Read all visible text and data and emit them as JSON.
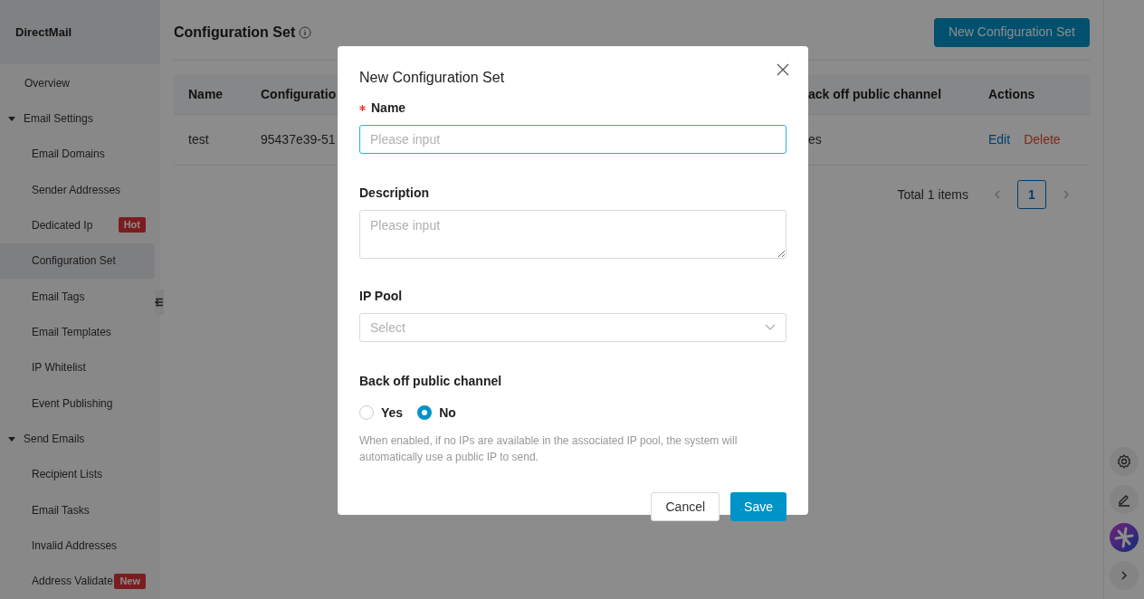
{
  "sidebar": {
    "title": "DirectMail",
    "items": [
      {
        "label": "Overview",
        "selected": false
      },
      {
        "label": "Email Settings",
        "expanded": true,
        "children": [
          {
            "label": "Email Domains",
            "selected": false
          },
          {
            "label": "Sender Addresses",
            "selected": false
          },
          {
            "label": "Dedicated Ip",
            "selected": false,
            "badge": "Hot"
          },
          {
            "label": "Configuration Set",
            "selected": true
          },
          {
            "label": "Email Tags",
            "selected": false
          },
          {
            "label": "Email Templates",
            "selected": false
          },
          {
            "label": "IP Whitelist",
            "selected": false
          },
          {
            "label": "Event Publishing",
            "selected": false
          }
        ]
      },
      {
        "label": "Send Emails",
        "expanded": true,
        "children": [
          {
            "label": "Recipient Lists",
            "selected": false
          },
          {
            "label": "Email Tasks",
            "selected": false
          },
          {
            "label": "Invalid Addresses",
            "selected": false
          },
          {
            "label": "Address Validate",
            "selected": false,
            "badge": "New"
          }
        ]
      }
    ]
  },
  "page": {
    "title": "Configuration Set",
    "new_button": "New Configuration Set"
  },
  "table": {
    "columns": [
      "Name",
      "Configuratio",
      "ack off public channel",
      "Actions"
    ],
    "rows": [
      {
        "cells": [
          "test",
          "95437e39-51",
          "es"
        ],
        "actions": [
          {
            "label": "Edit",
            "kind": "link"
          },
          {
            "label": "Delete",
            "kind": "danger"
          }
        ]
      }
    ]
  },
  "pagination": {
    "total": "Total 1 items",
    "pages": [
      {
        "label": "1",
        "selected": true
      }
    ]
  },
  "dialog": {
    "title": "New Configuration Set",
    "fields": [
      {
        "kind": "input",
        "label": "Name",
        "required": true,
        "focused": true,
        "placeholder": "Please input"
      },
      {
        "kind": "textarea",
        "label": "Description",
        "required": false,
        "focused": false,
        "placeholder": "Please input"
      },
      {
        "kind": "select",
        "label": "IP Pool",
        "required": false,
        "focused": false,
        "placeholder": "Select"
      },
      {
        "kind": "radio",
        "label": "Back off public channel",
        "required": false,
        "options": [
          {
            "label": "Yes",
            "selected": false
          },
          {
            "label": "No",
            "selected": true
          }
        ],
        "help": "When enabled, if no IPs are available in the associated IP pool, the system will automatically use a public IP to send."
      }
    ],
    "buttons": [
      {
        "kind": "secondary",
        "label": "Cancel"
      },
      {
        "kind": "primary",
        "label": "Save"
      }
    ]
  }
}
